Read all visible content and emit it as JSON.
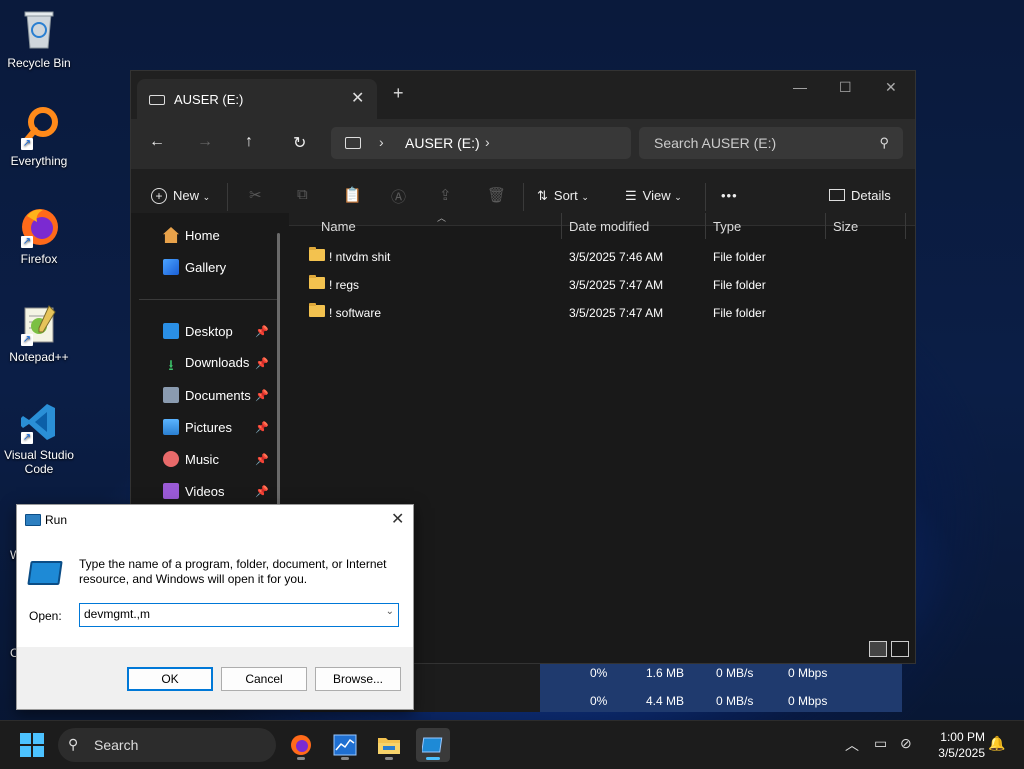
{
  "desktop": {
    "icons": [
      {
        "label": "Recycle Bin"
      },
      {
        "label": "Everything"
      },
      {
        "label": "Firefox"
      },
      {
        "label": "Notepad++"
      },
      {
        "label": "Visual Studio Code"
      }
    ],
    "partial_labels": [
      "W",
      "C"
    ]
  },
  "explorer": {
    "tab_title": "AUSER (E:)",
    "address": {
      "location": "AUSER (E:)"
    },
    "search_placeholder": "Search AUSER (E:)",
    "command_bar": {
      "new_label": "New",
      "sort_label": "Sort",
      "view_label": "View",
      "more_label": "•••",
      "details_label": "Details"
    },
    "nav_pane": {
      "items": [
        {
          "label": "Home"
        },
        {
          "label": "Gallery"
        },
        {
          "label": "Desktop"
        },
        {
          "label": "Downloads"
        },
        {
          "label": "Documents"
        },
        {
          "label": "Pictures"
        },
        {
          "label": "Music"
        },
        {
          "label": "Videos"
        }
      ]
    },
    "columns": {
      "name": "Name",
      "date": "Date modified",
      "type": "Type",
      "size": "Size"
    },
    "rows": [
      {
        "name": "! ntvdm shit",
        "date": "3/5/2025 7:46 AM",
        "type": "File folder"
      },
      {
        "name": "! regs",
        "date": "3/5/2025 7:47 AM",
        "type": "File folder"
      },
      {
        "name": "! software",
        "date": "3/5/2025 7:47 AM",
        "type": "File folder"
      }
    ]
  },
  "task_manager_rows": [
    {
      "cpu": "0%",
      "memory": "1.6 MB",
      "disk": "0 MB/s",
      "network": "0 Mbps"
    },
    {
      "cpu": "0%",
      "memory": "4.4 MB",
      "disk": "0 MB/s",
      "network": "0 Mbps"
    }
  ],
  "run_dialog": {
    "title": "Run",
    "description": "Type the name of a program, folder, document, or Internet resource, and Windows will open it for you.",
    "open_label": "Open:",
    "open_value": "devmgmt.,m",
    "ok_label": "OK",
    "cancel_label": "Cancel",
    "browse_label": "Browse..."
  },
  "taskbar": {
    "search_label": "Search",
    "time": "1:00 PM",
    "date": "3/5/2025"
  },
  "colors": {
    "accent": "#4cc2ff",
    "folder": "#f3c24f",
    "explorer_bg": "#191919"
  }
}
